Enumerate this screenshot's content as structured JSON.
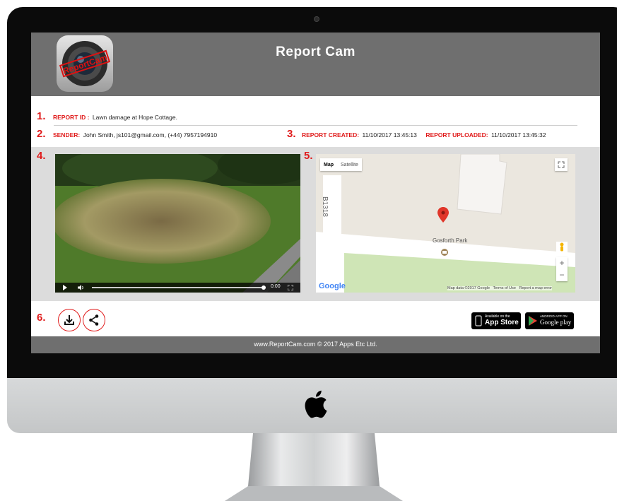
{
  "header": {
    "title": "Report Cam",
    "logo_text": "ReportCam"
  },
  "report": {
    "id_number": "1.",
    "id_label": "REPORT ID :",
    "id_value": "Lawn damage at Hope Cottage.",
    "sender_number": "2.",
    "sender_label": "SENDER:",
    "sender_value": "John Smith, js101@gmail.com, (+44) 7957194910",
    "created_number": "3.",
    "created_label": "REPORT CREATED:",
    "created_value": "11/10/2017 13:45:13",
    "uploaded_label": "REPORT UPLOADED:",
    "uploaded_value": "11/10/2017 13:45:32"
  },
  "video": {
    "number": "4.",
    "time": "0:00",
    "progress": 0.0
  },
  "map": {
    "number": "5.",
    "tab_map": "Map",
    "tab_satellite": "Satellite",
    "road_label": "B1318",
    "place_label": "Gosforth Park",
    "google_label": "Google",
    "attribution": "Map data ©2017 Google",
    "terms": "Terms of Use",
    "report_error": "Report a map error",
    "zoom_in": "+",
    "zoom_out": "−"
  },
  "actions": {
    "number": "6.",
    "download_icon": "download-icon",
    "share_icon": "share-icon",
    "appstore_small": "Available on the",
    "appstore_big": "App Store",
    "googleplay_small": "ANDROID APP ON",
    "googleplay_big": "Google play"
  },
  "footer": {
    "text": "www.ReportCam.com © 2017 Apps Etc Ltd."
  },
  "colors": {
    "accent": "#e01b1b",
    "header_bg": "#6f6f6f",
    "band_bg": "#dcdcdc"
  }
}
